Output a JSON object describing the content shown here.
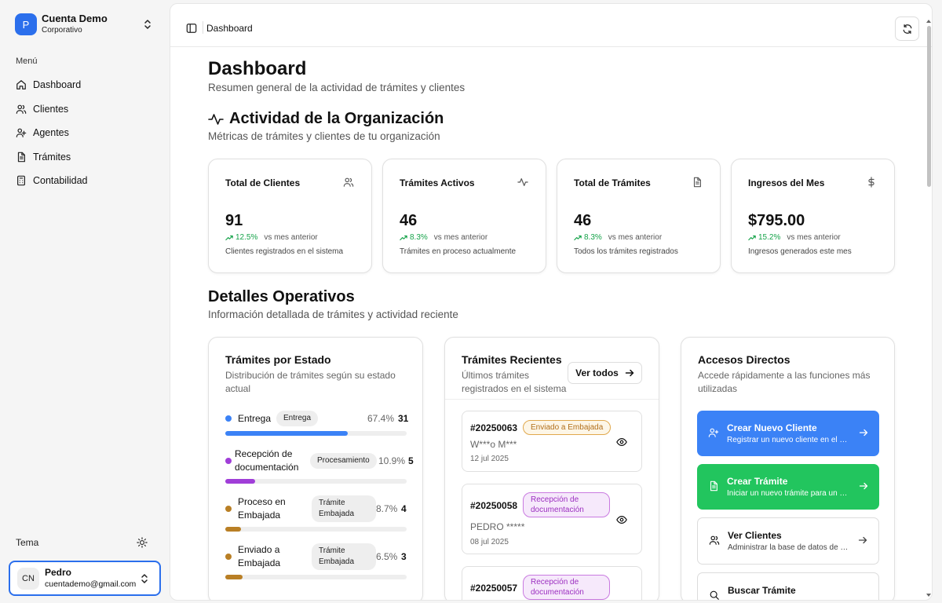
{
  "org": {
    "logo_letter": "P",
    "name": "Cuenta Demo",
    "plan": "Corporativo"
  },
  "sidebar": {
    "menu_label": "Menú",
    "items": [
      {
        "label": "Dashboard",
        "icon": "home-icon"
      },
      {
        "label": "Clientes",
        "icon": "users-icon"
      },
      {
        "label": "Agentes",
        "icon": "agents-icon"
      },
      {
        "label": "Trámites",
        "icon": "document-icon"
      },
      {
        "label": "Contabilidad",
        "icon": "calculator-icon"
      }
    ],
    "theme_label": "Tema"
  },
  "user": {
    "initials": "CN",
    "name": "Pedro",
    "email": "cuentademo@gmail.com"
  },
  "topbar": {
    "breadcrumb": "Dashboard"
  },
  "page": {
    "title": "Dashboard",
    "subtitle": "Resumen general de la actividad de trámites y clientes"
  },
  "activity": {
    "title": "Actividad de la Organización",
    "subtitle": "Métricas de trámites y clientes de tu organización",
    "stats": [
      {
        "title": "Total de Clientes",
        "value": "91",
        "pct": "12.5%",
        "trend_text": "vs mes anterior",
        "desc": "Clientes registrados en el sistema",
        "icon": "users-icon"
      },
      {
        "title": "Trámites Activos",
        "value": "46",
        "pct": "8.3%",
        "trend_text": "vs mes anterior",
        "desc": "Trámites en proceso actualmente",
        "icon": "activity-icon"
      },
      {
        "title": "Total de Trámites",
        "value": "46",
        "pct": "8.3%",
        "trend_text": "vs mes anterior",
        "desc": "Todos los trámites registrados",
        "icon": "document-icon"
      },
      {
        "title": "Ingresos del Mes",
        "value": "$795.00",
        "pct": "15.2%",
        "trend_text": "vs mes anterior",
        "desc": "Ingresos generados este mes",
        "icon": "dollar-icon"
      }
    ]
  },
  "details": {
    "title": "Detalles Operativos",
    "subtitle": "Información detallada de trámites y actividad reciente"
  },
  "estado": {
    "title": "Trámites por Estado",
    "subtitle": "Distribución de trámites según su estado actual",
    "items": [
      {
        "name": "Entrega",
        "badge": "Entrega",
        "pct": "67.4%",
        "count": "31",
        "fraction": 0.674,
        "color": "#3b82f6"
      },
      {
        "name": "Recepción de documentación",
        "badge": "Procesamiento",
        "pct": "10.9%",
        "count": "5",
        "fraction": 0.163,
        "color": "#a03ed8"
      },
      {
        "name": "Proceso en Embajada",
        "badge": "Trámite Embajada",
        "pct": "8.7%",
        "count": "4",
        "fraction": 0.087,
        "color": "#b97f25"
      },
      {
        "name": "Enviado a Embajada",
        "badge": "Trámite Embajada",
        "pct": "6.5%",
        "count": "3",
        "fraction": 0.095,
        "color": "#b97f25"
      }
    ]
  },
  "recientes": {
    "title": "Trámites Recientes",
    "subtitle": "Últimos trámites registrados en el sistema",
    "ver_todos": "Ver todos",
    "items": [
      {
        "id": "#20250063",
        "status": "Enviado a Embajada",
        "client": "W***o M***",
        "date": "12 jul 2025"
      },
      {
        "id": "#20250058",
        "status": "Recepción de documentación",
        "client": "PEDRO *****",
        "date": "08 jul 2025"
      },
      {
        "id": "#20250057",
        "status": "Recepción de documentación",
        "client": "",
        "date": ""
      }
    ]
  },
  "accesos": {
    "title": "Accesos Directos",
    "subtitle": "Accede rápidamente a las funciones más utilizadas",
    "items": [
      {
        "title": "Crear Nuevo Cliente",
        "desc": "Registrar un nuevo cliente en el sistema",
        "icon": "user-plus-icon"
      },
      {
        "title": "Crear Trámite",
        "desc": "Iniciar un nuevo trámite para un cliente",
        "icon": "document-icon"
      },
      {
        "title": "Ver Clientes",
        "desc": "Administrar la base de datos de clientes",
        "icon": "users-icon"
      },
      {
        "title": "Buscar Trámite",
        "desc": "",
        "icon": "search-icon"
      }
    ]
  },
  "colors": {
    "primary": "#2b6fec",
    "blue": "#3b82f6",
    "green": "#22c55e",
    "trend": "#16a34a"
  }
}
